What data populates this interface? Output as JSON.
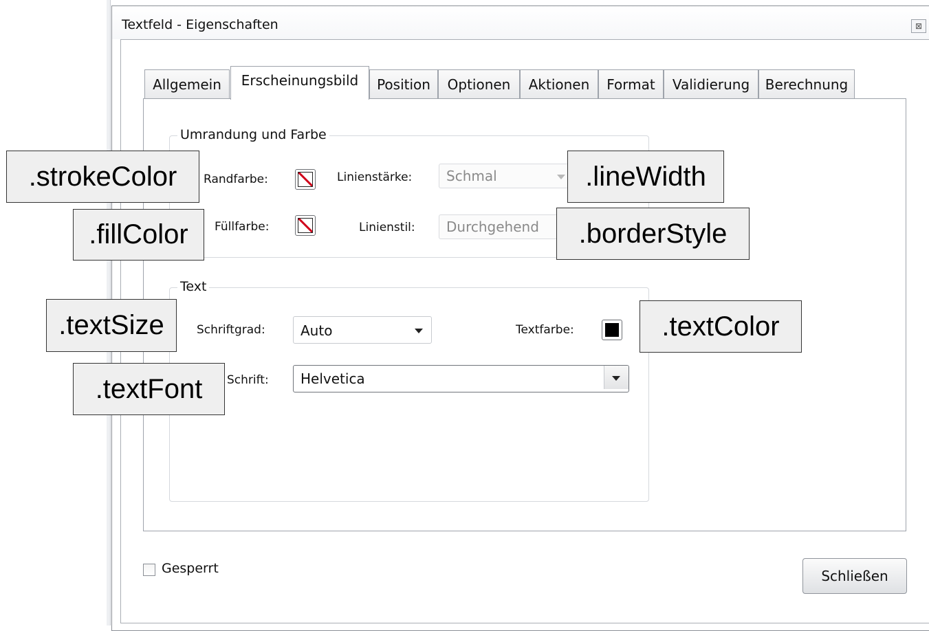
{
  "window": {
    "title": "Textfeld - Eigenschaften",
    "close_icon": "close-icon"
  },
  "tabs": [
    {
      "label": "Allgemein",
      "active": false
    },
    {
      "label": "Erscheinungsbild",
      "active": true
    },
    {
      "label": "Position",
      "active": false
    },
    {
      "label": "Optionen",
      "active": false
    },
    {
      "label": "Aktionen",
      "active": false
    },
    {
      "label": "Format",
      "active": false
    },
    {
      "label": "Validierung",
      "active": false
    },
    {
      "label": "Berechnung",
      "active": false
    }
  ],
  "border_group": {
    "title": "Umrandung und Farbe",
    "stroke_label": "Randfarbe:",
    "fill_label": "Füllfarbe:",
    "line_width_label": "Linienstärke:",
    "line_width_value": "Schmal",
    "line_style_label": "Linienstil:",
    "line_style_value": "Durchgehend"
  },
  "text_group": {
    "title": "Text",
    "size_label": "Schriftgrad:",
    "size_value": "Auto",
    "color_label": "Textfarbe:",
    "font_label": "Schrift:",
    "font_value": "Helvetica"
  },
  "footer": {
    "locked_label": "Gesperrt",
    "locked_checked": false,
    "close_button": "Schließen"
  },
  "annotations": {
    "stroke_color": ".strokeColor",
    "fill_color": ".fillColor",
    "line_width": ".lineWidth",
    "border_style": ".borderStyle",
    "text_size": ".textSize",
    "text_color": ".textColor",
    "text_font": ".textFont"
  },
  "colors": {
    "no_color_slash": "#d0021b",
    "text_color_swatch": "#000000"
  }
}
